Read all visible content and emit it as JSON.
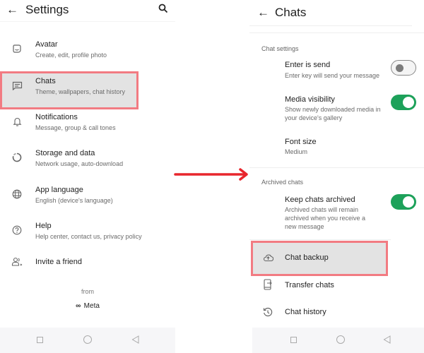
{
  "left_screen": {
    "title": "Settings",
    "back_icon": "arrow-left-icon",
    "search_icon": "search-icon",
    "items": [
      {
        "icon": "avatar-icon",
        "label": "Avatar",
        "sub": "Create, edit, profile photo"
      },
      {
        "icon": "chat-icon",
        "label": "Chats",
        "sub": "Theme, wallpapers, chat history",
        "highlighted": true
      },
      {
        "icon": "bell-icon",
        "label": "Notifications",
        "sub": "Message, group & call tones"
      },
      {
        "icon": "storage-icon",
        "label": "Storage and data",
        "sub": "Network usage, auto-download"
      },
      {
        "icon": "globe-icon",
        "label": "App language",
        "sub": "English (device's language)"
      },
      {
        "icon": "help-icon",
        "label": "Help",
        "sub": "Help center, contact us, privacy policy"
      },
      {
        "icon": "invite-icon",
        "label": "Invite a friend",
        "sub": ""
      }
    ],
    "footer_from": "from",
    "footer_brand": "Meta"
  },
  "arrow": {
    "color": "#e8262d",
    "icon": "arrow-right-icon"
  },
  "right_screen": {
    "title": "Chats",
    "back_icon": "arrow-left-icon",
    "sections": [
      {
        "header": "Chat settings",
        "items": [
          {
            "label": "Enter is send",
            "sub": "Enter key will send your message",
            "toggle": false
          },
          {
            "label": "Media visibility",
            "sub": "Show newly downloaded media in your device's gallery",
            "toggle": true
          },
          {
            "label": "Font size",
            "sub": "Medium"
          }
        ]
      },
      {
        "header": "Archived chats",
        "items": [
          {
            "label": "Keep chats archived",
            "sub": "Archived chats will remain archived when you receive a new message",
            "toggle": true
          }
        ]
      }
    ],
    "actions": [
      {
        "icon": "cloud-upload-icon",
        "label": "Chat backup",
        "highlighted": true
      },
      {
        "icon": "transfer-phone-icon",
        "label": "Transfer chats"
      },
      {
        "icon": "history-icon",
        "label": "Chat history"
      }
    ]
  },
  "colors": {
    "highlight_border": "#f27b82",
    "toggle_on": "#1da15a",
    "arrow": "#e8262d"
  }
}
